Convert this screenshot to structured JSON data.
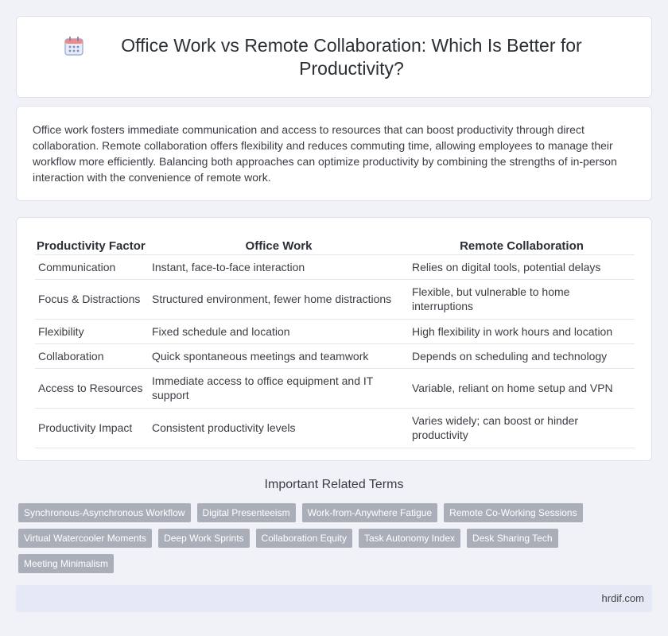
{
  "header": {
    "title": "Office Work vs Remote Collaboration: Which Is Better for Productivity?",
    "icon": "calendar-icon"
  },
  "intro": {
    "text": "Office work fosters immediate communication and access to resources that can boost productivity through direct collaboration. Remote collaboration offers flexibility and reduces commuting time, allowing employees to manage their workflow more efficiently. Balancing both approaches can optimize productivity by combining the strengths of in-person interaction with the convenience of remote work."
  },
  "table": {
    "headers": [
      "Productivity Factor",
      "Office Work",
      "Remote Collaboration"
    ],
    "rows": [
      [
        "Communication",
        "Instant, face-to-face interaction",
        "Relies on digital tools, potential delays"
      ],
      [
        "Focus & Distractions",
        "Structured environment, fewer home distractions",
        "Flexible, but vulnerable to home interruptions"
      ],
      [
        "Flexibility",
        "Fixed schedule and location",
        "High flexibility in work hours and location"
      ],
      [
        "Collaboration",
        "Quick spontaneous meetings and teamwork",
        "Depends on scheduling and technology"
      ],
      [
        "Access to Resources",
        "Immediate access to office equipment and IT support",
        "Variable, reliant on home setup and VPN"
      ],
      [
        "Productivity Impact",
        "Consistent productivity levels",
        "Varies widely; can boost or hinder productivity"
      ]
    ]
  },
  "related": {
    "title": "Important Related Terms",
    "tags": [
      "Synchronous-Asynchronous Workflow",
      "Digital Presenteeism",
      "Work-from-Anywhere Fatigue",
      "Remote Co-Working Sessions",
      "Virtual Watercooler Moments",
      "Deep Work Sprints",
      "Collaboration Equity",
      "Task Autonomy Index",
      "Desk Sharing Tech",
      "Meeting Minimalism"
    ]
  },
  "footer": {
    "site": "hrdif.com"
  },
  "colors": {
    "background": "#f0f2f8",
    "tag": "#a9aeb9",
    "footer": "#e5e9f5"
  }
}
